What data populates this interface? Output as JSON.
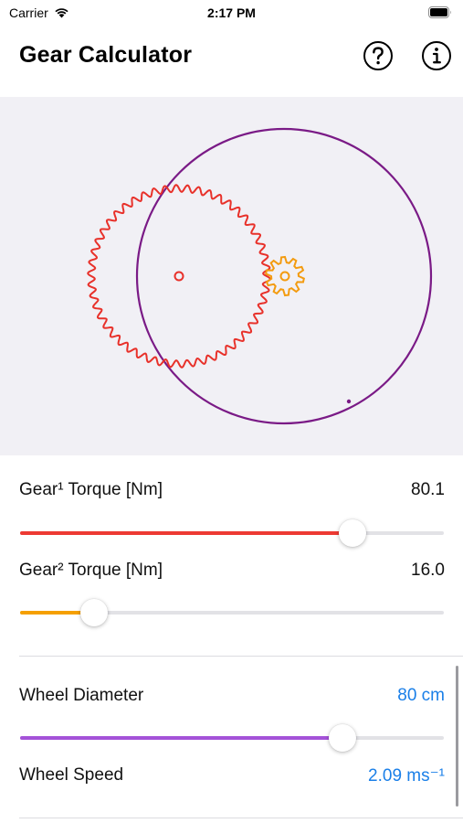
{
  "status_bar": {
    "carrier": "Carrier",
    "time": "2:17 PM"
  },
  "nav": {
    "title": "Gear Calculator",
    "help_icon": "question-circle",
    "info_icon": "info-circle"
  },
  "colors": {
    "gear1": "#e8312a",
    "gear2": "#f39b0f",
    "wheel": "#7a1a86",
    "gear1_slider": "#ed3a33",
    "gear2_slider": "#f5a000",
    "wheel_slider": "#a452d8",
    "value_blue": "#1a7fe8"
  },
  "gear1_torque": {
    "label": "Gear¹ Torque [Nm]",
    "value": "80.1",
    "slider_fraction": 0.784
  },
  "gear2_torque": {
    "label": "Gear² Torque [Nm]",
    "value": "16.0",
    "slider_fraction": 0.175
  },
  "wheel_diameter": {
    "label": "Wheel Diameter",
    "value": "80 cm",
    "slider_fraction": 0.76
  },
  "wheel_speed": {
    "label": "Wheel Speed",
    "value": "2.09 ms⁻¹"
  }
}
